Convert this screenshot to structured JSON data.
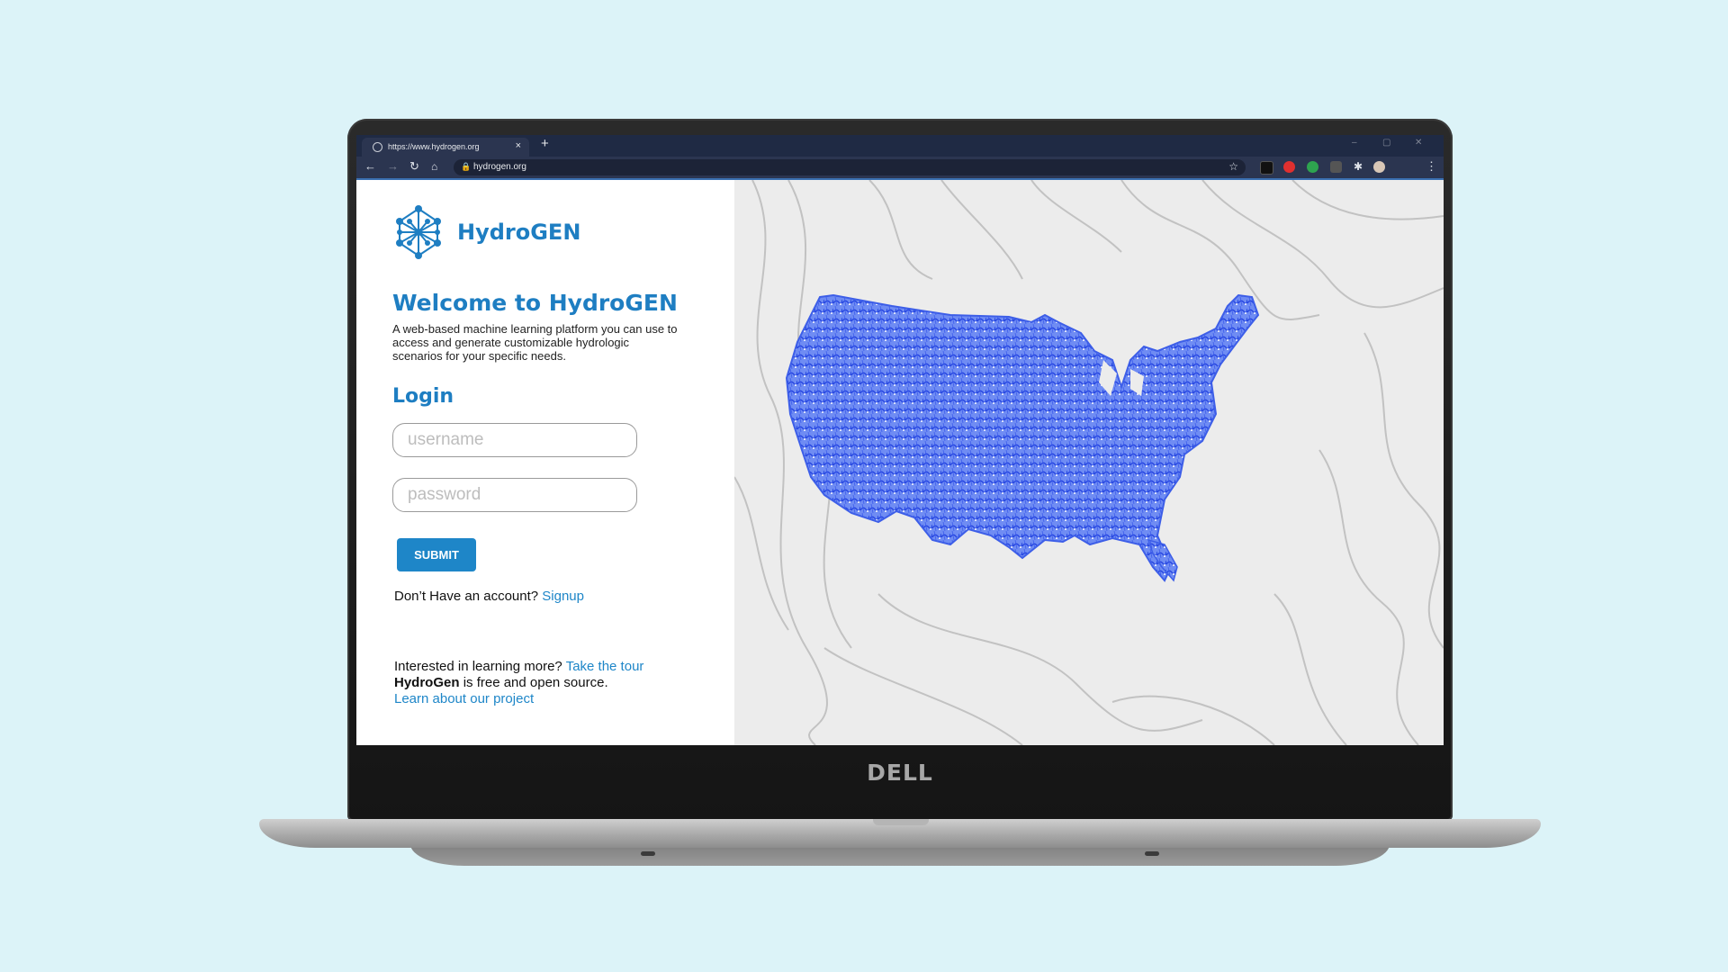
{
  "device": {
    "brand": "DELL"
  },
  "browser": {
    "tab_title": "https://www.hydrogen.org",
    "tab_close": "×",
    "new_tab": "+",
    "url": "hydrogen.org",
    "window_controls": [
      "–",
      "▢",
      "✕"
    ]
  },
  "page": {
    "brand_name": "HydroGEN",
    "welcome_title": "Welcome to HydroGEN",
    "description": "A web-based machine learning platform you can use to access and generate customizable hydrologic scenarios for your specific needs.",
    "login_heading": "Login",
    "username_placeholder": "username",
    "password_placeholder": "password",
    "submit_label": "SUBMIT",
    "signup_prompt": "Don’t Have an account?",
    "signup_link": "Signup",
    "learn_prompt": "Interested in learning more?",
    "tour_link": "Take the tour",
    "oss_brand": "HydroGen",
    "oss_text": "is free and open source.",
    "project_link": "Learn about our project"
  },
  "colors": {
    "accent": "#1e7ec2",
    "map_blue": "#2f56e6",
    "tab_bar": "#1f2a44"
  },
  "icons": [
    "globe-icon",
    "back-icon",
    "forward-icon",
    "reload-icon",
    "home-icon",
    "lock-icon",
    "star-icon",
    "extension-icon",
    "profile-icon",
    "menu-icon",
    "neural-network-logo"
  ]
}
